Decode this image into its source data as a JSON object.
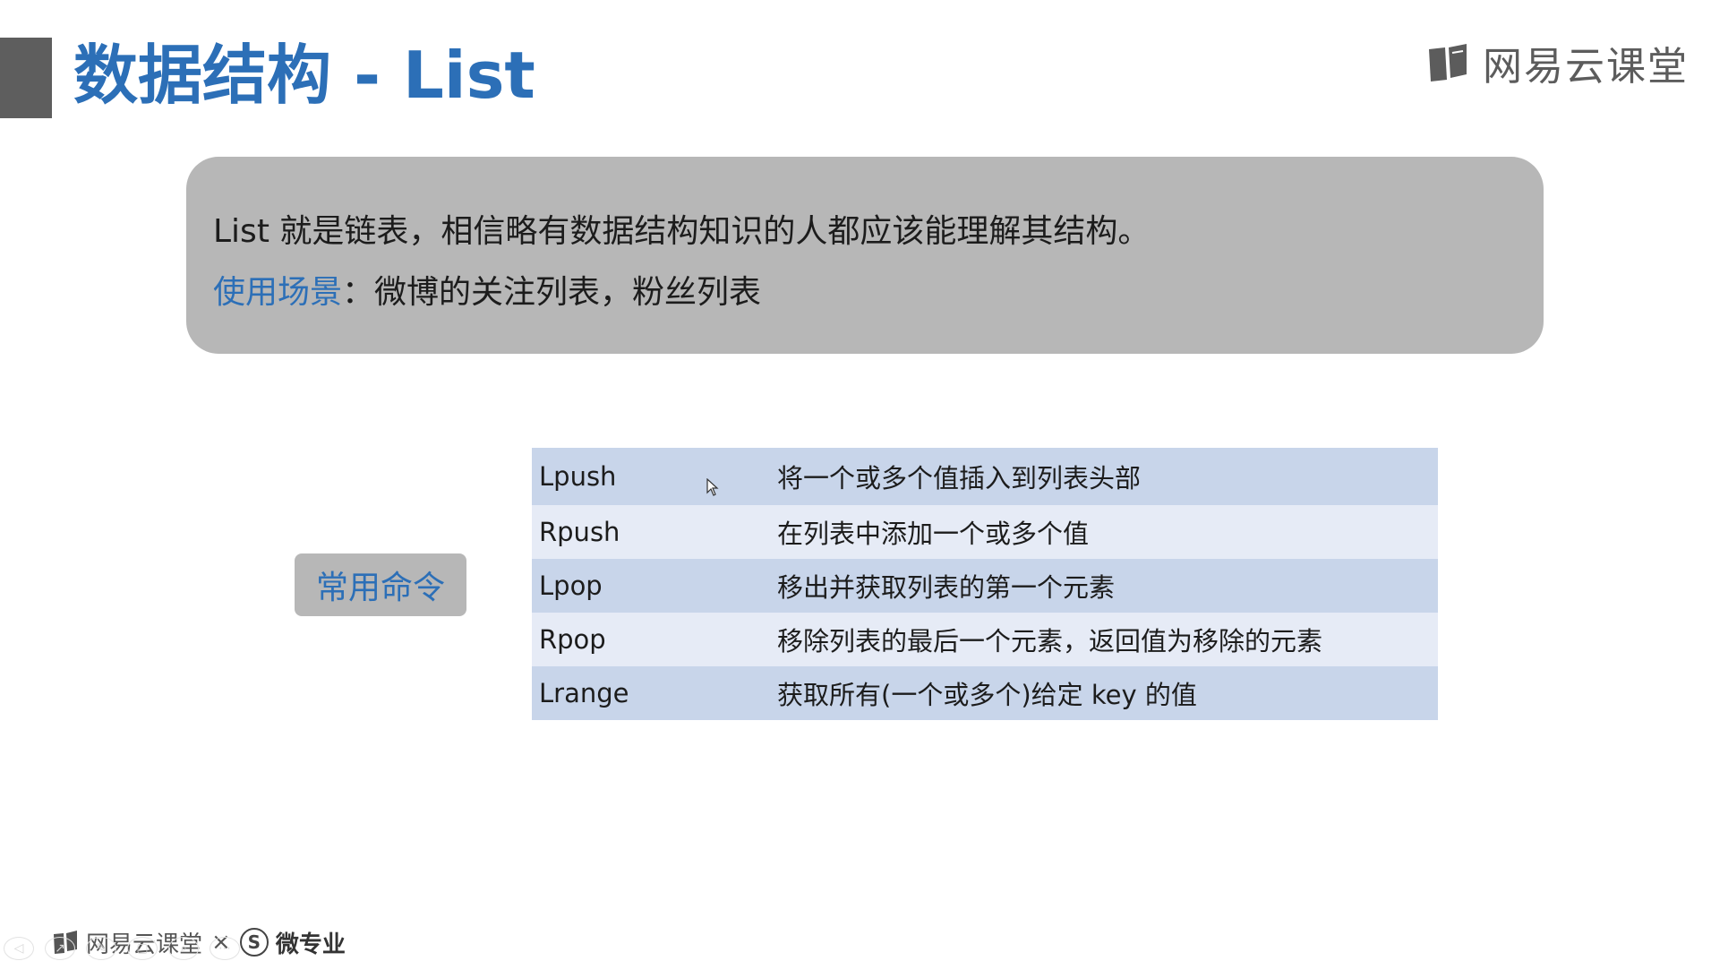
{
  "slide": {
    "title": "数据结构 - List",
    "brand": "网易云课堂",
    "intro": {
      "line1": "List 就是链表，相信略有数据结构知识的人都应该能理解其结构。",
      "scenario_label": "使用场景",
      "scenario_sep": "：",
      "scenario_text": "微博的关注列表，粉丝列表"
    },
    "commands_label": "常用命令",
    "commands": [
      {
        "name": "Lpush",
        "desc": "将一个或多个值插入到列表头部"
      },
      {
        "name": "Rpush",
        "desc": "在列表中添加一个或多个值"
      },
      {
        "name": "Lpop",
        "desc": "移出并获取列表的第一个元素"
      },
      {
        "name": "Rpop",
        "desc": "移除列表的最后一个元素，返回值为移除的元素"
      },
      {
        "name": "Lrange",
        "desc": "获取所有(一个或多个)给定 key 的值"
      }
    ]
  },
  "footer": {
    "brand": "网易云课堂",
    "times": "×",
    "s_mark": "S",
    "partner": "微专业"
  },
  "colors": {
    "accent_blue": "#2c6fb7",
    "box_gray": "#b7b7b7",
    "row_dark": "#c8d5ea",
    "row_light": "#e6ebf6"
  },
  "icons": {
    "brand_logo": "book-icon",
    "cursor": "arrow-cursor-icon"
  }
}
